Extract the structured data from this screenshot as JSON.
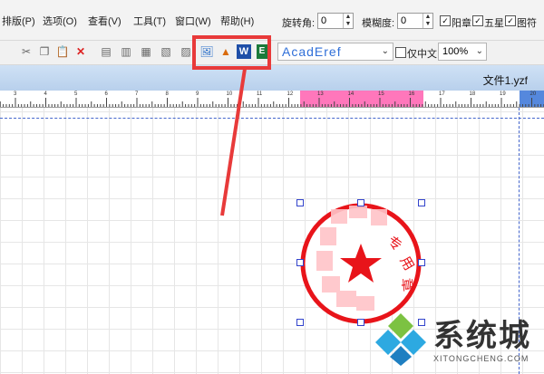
{
  "menu": {
    "items": [
      "排版(P)",
      "选项(O)",
      "查看(V)",
      "工具(T)",
      "窗口(W)",
      "帮助(H)"
    ]
  },
  "props": {
    "rotation_label": "旋转角:",
    "rotation_value": "0",
    "blur_label": "模糊度:",
    "blur_value": "0",
    "checks": [
      {
        "label": "阳章",
        "checked": true
      },
      {
        "label": "五星",
        "checked": true
      },
      {
        "label": "图符",
        "checked": true
      }
    ]
  },
  "toolbar": {
    "font_value": "AcadEref",
    "cn_only_label": "仅中文",
    "zoom_value": "100%"
  },
  "document": {
    "tab_name": "文件1.yzf"
  },
  "ruler": {
    "numbers": [
      "3",
      "4",
      "5",
      "6",
      "7",
      "8",
      "9",
      "10",
      "11",
      "12",
      "13",
      "14",
      "15",
      "16",
      "17",
      "18",
      "19",
      "20",
      "21"
    ]
  },
  "seal": {
    "text_chars": [
      "专",
      "用",
      "章"
    ]
  },
  "watermark": {
    "text": "系统城",
    "url": "XITONGCHENG.COM"
  },
  "colors": {
    "accent_red": "#e83a3a",
    "seal_red": "#e8141a",
    "ruler_pink": "#ff77bb",
    "ruler_blue": "#5588dd"
  }
}
